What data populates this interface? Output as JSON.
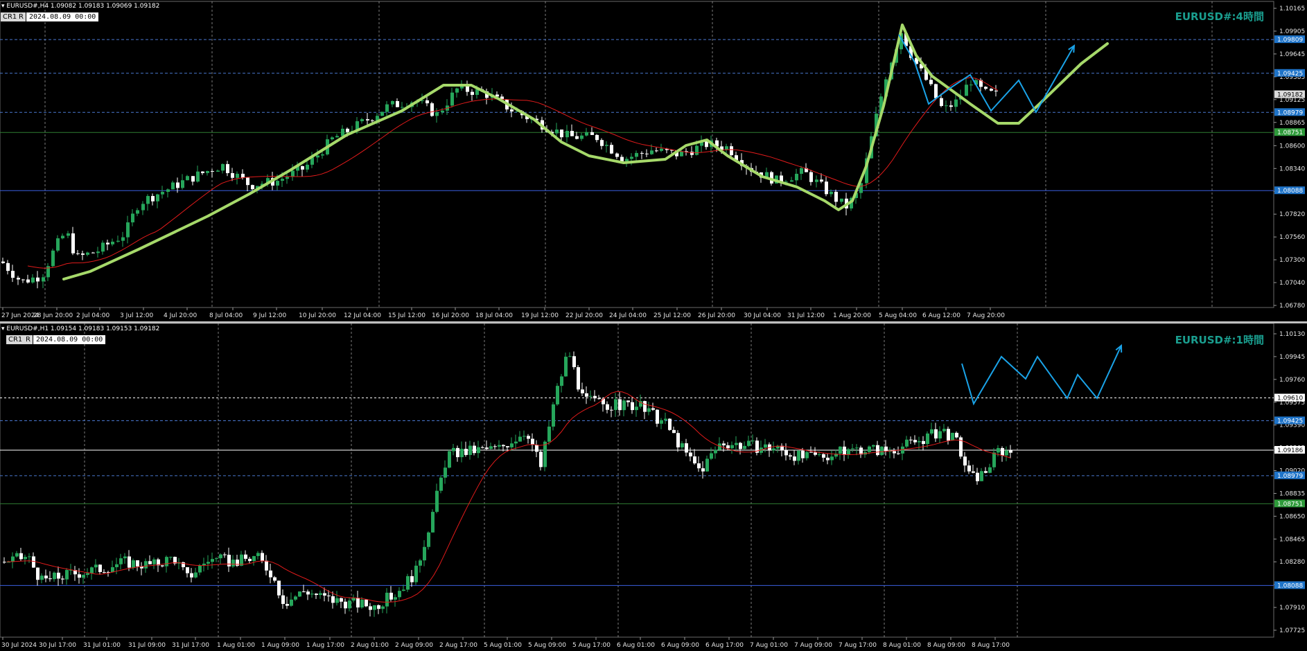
{
  "colors": {
    "bg": "#000000",
    "bull": "#26a65b",
    "bear": "#ffffff",
    "ma": "#e31b1b",
    "green_path": "#a6d96a",
    "blue_path": "#1aa3e8",
    "grid": "#b0b0b0",
    "hline_dash": "#4a78d0",
    "hline_solid": "#3b5fe0",
    "hline_green": "#2e7d32"
  },
  "h4": {
    "header": "EURUSD#,H4  1.09082 1.09183 1.09069 1.09182",
    "cr1": "CR1",
    "r": "R",
    "date": "2024.08.09 00:00",
    "title": "EURUSD#:4時間",
    "ticks": [
      "1.10165",
      "1.09905",
      "1.09645",
      "1.09385",
      "1.09125",
      "1.08865",
      "1.08600",
      "1.08340",
      "1.08080",
      "1.07820",
      "1.07560",
      "1.07300",
      "1.07040",
      "1.06780"
    ],
    "badges": [
      {
        "text": "1.09809",
        "color": "#1e73c8"
      },
      {
        "text": "1.09425",
        "color": "#1e73c8"
      },
      {
        "text": "1.09182",
        "color": "#dcdcdc"
      },
      {
        "text": "1.08979",
        "color": "#1e73c8"
      },
      {
        "text": "1.08751",
        "color": "#2e9b3a"
      },
      {
        "text": "1.08088",
        "color": "#1e73c8"
      }
    ],
    "xlabels": [
      "27 Jun 2024",
      "28 Jun 20:00",
      "2 Jul 04:00",
      "3 Jul 12:00",
      "4 Jul 20:00",
      "8 Jul 04:00",
      "9 Jul 12:00",
      "10 Jul 20:00",
      "12 Jul 04:00",
      "15 Jul 12:00",
      "16 Jul 20:00",
      "18 Jul 04:00",
      "19 Jul 12:00",
      "22 Jul 20:00",
      "24 Jul 04:00",
      "25 Jul 12:00",
      "26 Jul 20:00",
      "30 Jul 04:00",
      "31 Jul 12:00",
      "1 Aug 20:00",
      "5 Aug 04:00",
      "6 Aug 12:00",
      "7 Aug 20:00"
    ]
  },
  "h1": {
    "header": "EURUSD#,H1  1.09154 1.09183 1.09153 1.09182",
    "cr1": "CR1",
    "r": "R",
    "date": "2024.08.09 00:00",
    "title": "EURUSD#:1時間",
    "ticks": [
      "1.10130",
      "1.09945",
      "1.09760",
      "1.09575",
      "1.09390",
      "1.09205",
      "1.09020",
      "1.08835",
      "1.08650",
      "1.08465",
      "1.08280",
      "1.08095",
      "1.07910",
      "1.07725"
    ],
    "badges": [
      {
        "text": "1.09610",
        "color": "#ffffff"
      },
      {
        "text": "1.09425",
        "color": "#1e73c8"
      },
      {
        "text": "1.09186",
        "color": "#ffffff"
      },
      {
        "text": "1.08979",
        "color": "#1e73c8"
      },
      {
        "text": "1.08751",
        "color": "#2e9b3a"
      },
      {
        "text": "1.08088",
        "color": "#1e73c8"
      }
    ],
    "xlabels": [
      "30 Jul 2024",
      "30 Jul 17:00",
      "31 Jul 01:00",
      "31 Jul 09:00",
      "31 Jul 17:00",
      "1 Aug 01:00",
      "1 Aug 09:00",
      "1 Aug 17:00",
      "2 Aug 01:00",
      "2 Aug 09:00",
      "2 Aug 17:00",
      "5 Aug 01:00",
      "5 Aug 09:00",
      "5 Aug 17:00",
      "6 Aug 01:00",
      "6 Aug 09:00",
      "6 Aug 17:00",
      "7 Aug 01:00",
      "7 Aug 09:00",
      "7 Aug 17:00",
      "8 Aug 01:00",
      "8 Aug 09:00",
      "8 Aug 17:00"
    ]
  }
}
